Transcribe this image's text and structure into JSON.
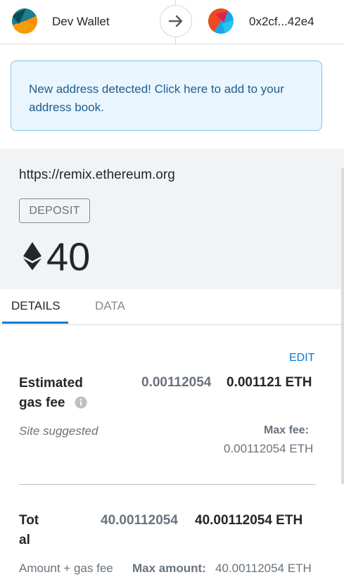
{
  "header": {
    "from_account": "Dev Wallet",
    "to_account": "0x2cf...42e4"
  },
  "notice": {
    "text": "New address detected! Click here to add to your address book."
  },
  "summary": {
    "origin": "https://remix.ethereum.org",
    "action_label": "DEPOSIT",
    "amount": "40"
  },
  "tabs": [
    {
      "label": "DETAILS"
    },
    {
      "label": "DATA"
    }
  ],
  "details": {
    "edit_label": "EDIT",
    "gas": {
      "label_line1": "Estimated",
      "label_line2": "gas fee",
      "primary_value": "0.00112054",
      "secondary_value": "0.001121 ETH",
      "note": "Site suggested",
      "max_fee_label": "Max fee:",
      "max_fee_value": "0.00112054 ETH"
    },
    "total": {
      "label_line1": "Tot",
      "label_line2": "al",
      "primary_value": "40.00112054",
      "secondary_value": "40.00112054 ETH",
      "note": "Amount + gas fee",
      "max_amount_label": "Max amount:",
      "max_amount_value": "40.00112054 ETH"
    }
  },
  "colors": {
    "accent": "#037dd6",
    "notice_bg": "#eaf6ff",
    "notice_border": "#7fc1ee",
    "summary_bg": "#f2f3f4"
  }
}
